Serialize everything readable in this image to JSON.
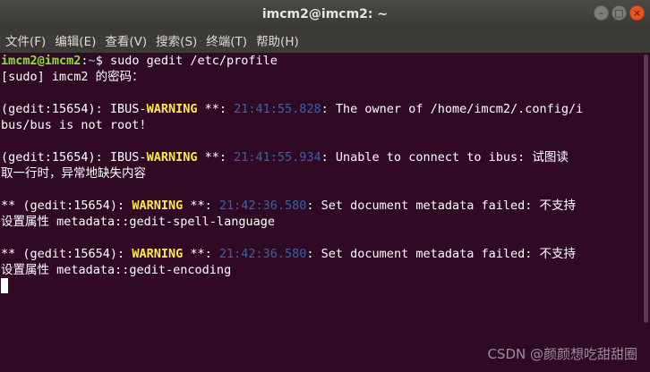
{
  "window": {
    "title": "imcm2@imcm2: ~"
  },
  "wm_buttons": [
    "–",
    "□",
    "×"
  ],
  "menu": [
    "文件(F)",
    "编辑(E)",
    "查看(V)",
    "搜索(S)",
    "终端(T)",
    "帮助(H)"
  ],
  "terminal": {
    "prompt_user": "imcm2@imcm2",
    "prompt_sep": ":",
    "prompt_path": "~",
    "prompt_dollar": "$ ",
    "command": "sudo gedit /etc/profile",
    "sudo_prompt": "[sudo] imcm2 的密码：",
    "w1_prefix": "(gedit:15654): IBUS-",
    "w1_warn": "WARNING",
    "w1_mid": " **: ",
    "w1_time": "21:41:55.828",
    "w1_msg": ": The owner of /home/imcm2/.config/i",
    "w1_cont": "bus/bus is not root!",
    "w2_prefix": "(gedit:15654): IBUS-",
    "w2_warn": "WARNING",
    "w2_mid": " **: ",
    "w2_time": "21:41:55.934",
    "w2_msg": ": Unable to connect to ibus: 试图读",
    "w2_cont": "取一行时，异常地缺失内容",
    "w3_prefix": "** (gedit:15654): ",
    "w3_warn": "WARNING",
    "w3_mid": " **: ",
    "w3_time": "21:42:36.580",
    "w3_msg": ": Set document metadata failed: 不支持",
    "w3_cont": "设置属性 metadata::gedit-spell-language",
    "w4_prefix": "** (gedit:15654): ",
    "w4_warn": "WARNING",
    "w4_mid": " **: ",
    "w4_time": "21:42:36.580",
    "w4_msg": ": Set document metadata failed: 不支持",
    "w4_cont": "设置属性 metadata::gedit-encoding"
  },
  "watermark": "CSDN @颜颜想吃甜甜圈",
  "colors": {
    "background": "#300a24",
    "prompt_user": "#8ae234",
    "prompt_path": "#729fcf",
    "warning": "#fce94f",
    "timestamp": "#3465a4",
    "close_button": "#e95420"
  }
}
